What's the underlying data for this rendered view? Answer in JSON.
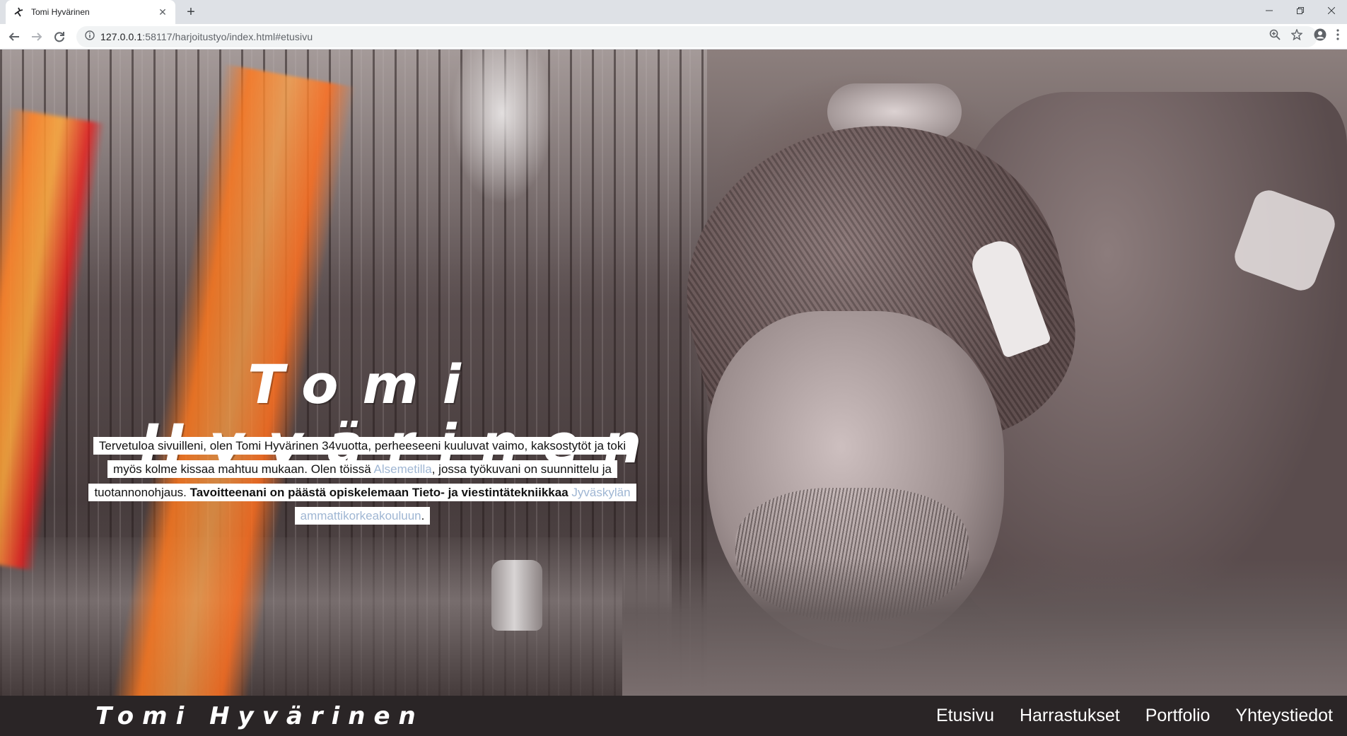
{
  "browser": {
    "tab_title": "Tomi Hyvärinen",
    "new_tab_label": "+",
    "url_host": "127.0.0.1",
    "url_rest": ":58117/harjoitustyo/index.html#etusivu"
  },
  "hero": {
    "title_line1": "Tomi",
    "title_line2": "Hyvärinen",
    "intro": {
      "line1": "Tervetuloa sivuilleni, olen Tomi Hyvärinen 34vuotta, perheeseeni kuuluvat vaimo, kaksostytöt ja toki",
      "line2_a": "myös kolme kissaa mahtuu mukaan. Olen töissä ",
      "link_employer": "Alsemetilla",
      "line2_b": ", jossa työkuvani on suunnittelu ja",
      "line3_a": "tuotannonohjaus. ",
      "goal_bold": "Tavoitteenani on päästä opiskelemaan Tieto- ja viestintätekniikkaa",
      "line3_space": " ",
      "link_school_1": "Jyväskylän",
      "link_school_2": "ammattikorkeakouluun",
      "line4_end": "."
    }
  },
  "navbar": {
    "brand": "Tomi Hyvärinen",
    "links": [
      "Etusivu",
      "Harrastukset",
      "Portfolio",
      "Yhteystiedot"
    ]
  },
  "colors": {
    "nav_bg": "#2a2526",
    "link": "#9fb6d3",
    "flare_orange": "#ff8a30",
    "flare_red": "#e61e1e"
  }
}
